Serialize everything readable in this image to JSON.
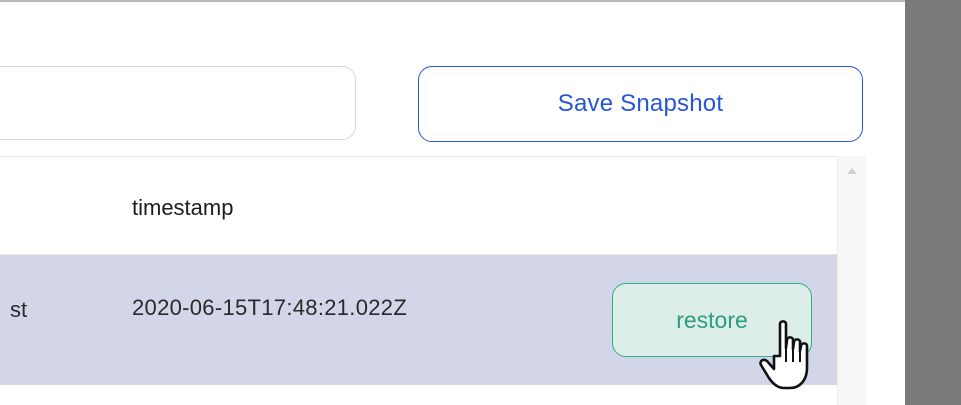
{
  "snapshot_form": {
    "name_input_value": "",
    "save_button_label": "Save Snapshot"
  },
  "table": {
    "columns": [
      {
        "label": ""
      },
      {
        "label": "timestamp"
      }
    ],
    "rows": [
      {
        "name_partial": "st",
        "timestamp": "2020-06-15T17:48:21.022Z",
        "action_label": "restore"
      }
    ]
  },
  "colors": {
    "accent_blue": "#2855d8",
    "accent_green": "#2cae8f",
    "selected_row": "#d3d5e9",
    "overlay": "#7a7a7a"
  },
  "icons": {
    "cursor": "hand-pointer-icon",
    "scroll_up": "scroll-up-arrow-icon"
  }
}
